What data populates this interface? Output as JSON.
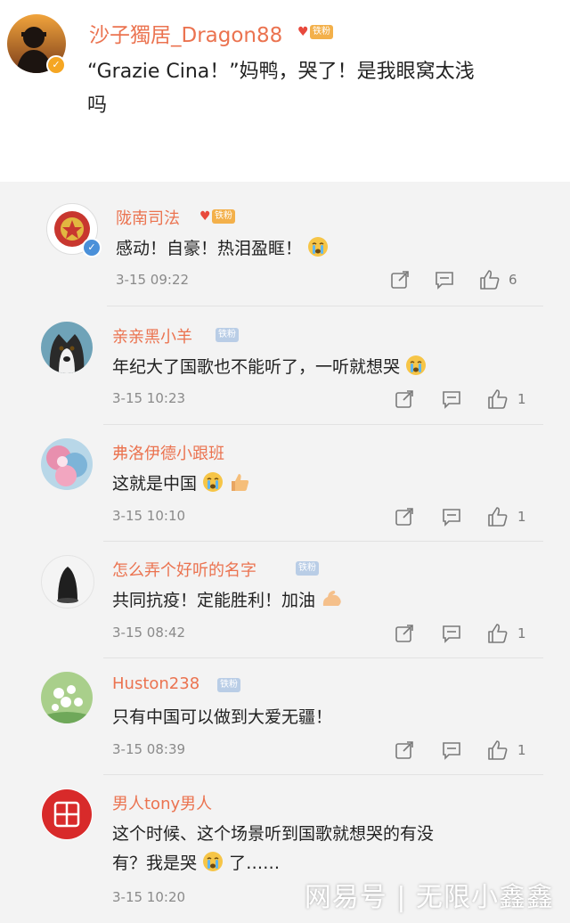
{
  "main_post": {
    "username": "沙子獨居_Dragon88",
    "fan_badge": "铁粉",
    "text_line1": "“Grazie Cina！”妈鸭，哭了！是我眼窝太浅",
    "text_line2": "吗"
  },
  "replies": [
    {
      "username": "陇南司法",
      "fan_badge": "铁粉",
      "text": "感动！自豪！热泪盈眶！",
      "time": "3-15 09:22",
      "likes": "6"
    },
    {
      "username": "亲亲黑小羊",
      "fan_badge": "铁粉",
      "text": "年纪大了国歌也不能听了，一听就想哭",
      "time": "3-15 10:23",
      "likes": "1"
    },
    {
      "username": "弗洛伊德小跟班",
      "fan_badge": "",
      "text": "这就是中国",
      "time": "3-15 10:10",
      "likes": "1"
    },
    {
      "username": "怎么弄个好听的名字",
      "fan_badge": "铁粉",
      "text": "共同抗疫！定能胜利！加油",
      "time": "3-15 08:42",
      "likes": "1"
    },
    {
      "username": "Huston238",
      "fan_badge": "铁粉",
      "text": "只有中国可以做到大爱无疆！",
      "time": "3-15 08:39",
      "likes": "1"
    },
    {
      "username": "男人tony男人",
      "fan_badge": "",
      "text_line1": "这个时候、这个场景听到国歌就想哭的有没",
      "text_line2": "有？我是哭",
      "text_line2_end": "了……",
      "time": "3-15 10:20",
      "likes": ""
    }
  ],
  "watermark": "网易号 | 无限小鑫鑫",
  "colors": {
    "username": "#eb7350",
    "background": "#f3f3f3",
    "verified": "#f5a623"
  }
}
